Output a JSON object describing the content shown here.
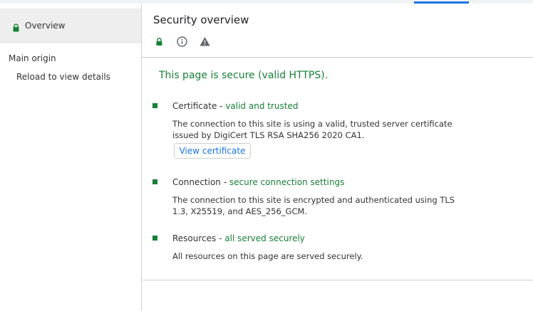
{
  "sidebar": {
    "overview_label": "Overview",
    "section_label": "Main origin",
    "sub_label": "Reload to view details"
  },
  "header": {
    "title": "Security overview",
    "icons": [
      "lock-icon",
      "info-icon",
      "warning-icon"
    ]
  },
  "summary": "This page is secure (valid HTTPS).",
  "items": [
    {
      "label": "Certificate",
      "sep": " - ",
      "status": "valid and trusted",
      "description": "The connection to this site is using a valid, trusted server certificate issued by DigiCert TLS RSA SHA256 2020 CA1."
    },
    {
      "label": "Connection",
      "sep": " - ",
      "status": "secure connection settings",
      "description": "The connection to this site is encrypted and authenticated using TLS 1.3, X25519, and AES_256_GCM."
    },
    {
      "label": "Resources",
      "sep": " - ",
      "status": "all served securely",
      "description": "All resources on this page are served securely."
    }
  ],
  "view_certificate_label": "View certificate",
  "colors": {
    "secure_green": "#188038",
    "link_blue": "#1a73e8"
  }
}
